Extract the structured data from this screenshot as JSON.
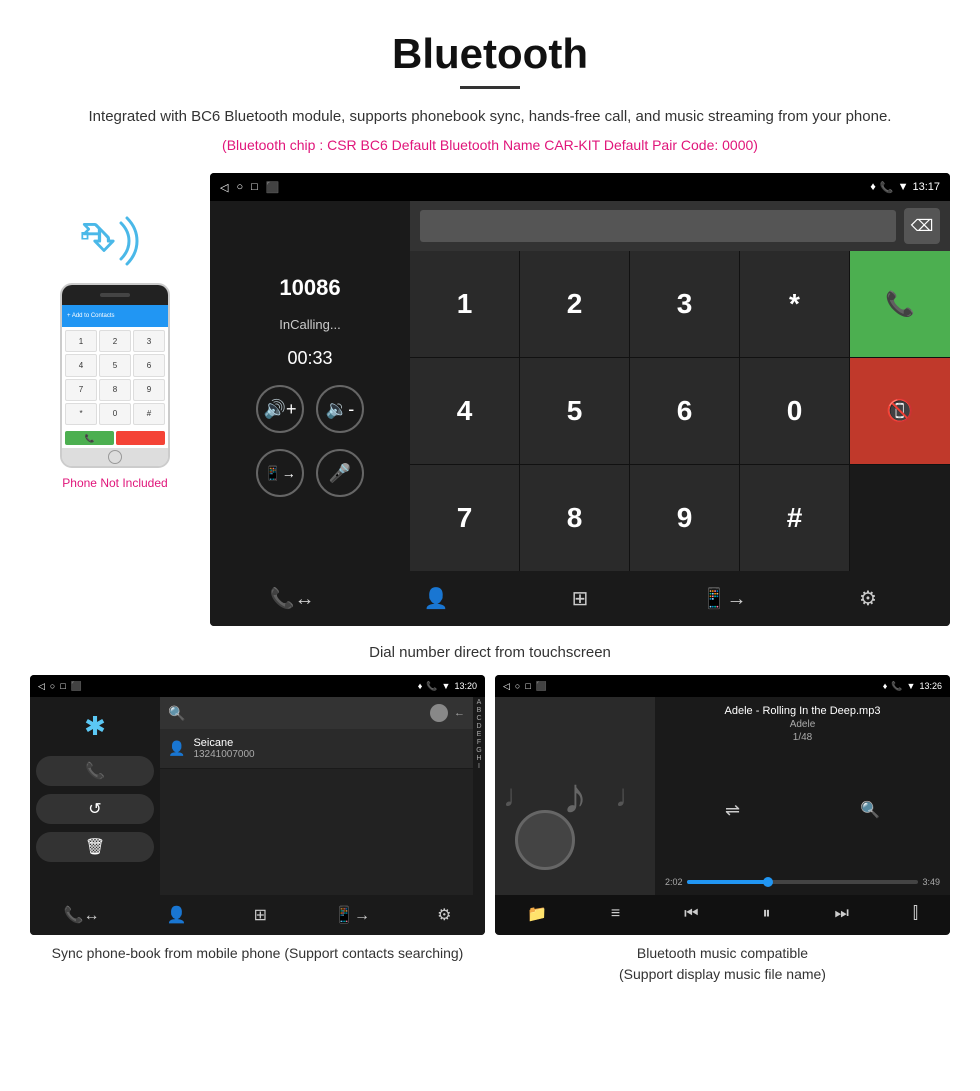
{
  "header": {
    "title": "Bluetooth",
    "description": "Integrated with BC6 Bluetooth module, supports phonebook sync, hands-free call, and music streaming from your phone.",
    "specs": "(Bluetooth chip : CSR BC6    Default Bluetooth Name CAR-KIT    Default Pair Code: 0000)"
  },
  "main_screen": {
    "status_bar": {
      "left": [
        "◁",
        "○",
        "□",
        "⬛"
      ],
      "right": [
        "♥",
        "📞",
        "▼",
        "13:17"
      ]
    },
    "dialer": {
      "number": "10086",
      "status": "InCalling...",
      "timer": "00:33"
    },
    "keypad": {
      "keys": [
        "1",
        "2",
        "3",
        "*",
        "4",
        "5",
        "6",
        "0",
        "7",
        "8",
        "9",
        "#"
      ]
    }
  },
  "main_caption": "Dial number direct from touchscreen",
  "phone": {
    "label": "Phone Not Included",
    "add_contacts": "+ Add to Contacts",
    "keys": [
      "1",
      "2",
      "3",
      "4",
      "5",
      "6",
      "7",
      "8",
      "9",
      "*",
      "0",
      "#"
    ]
  },
  "phonebook_screen": {
    "status_right": "◀ ○ □ ⬛",
    "time": "13:20",
    "contact": {
      "name": "Seicane",
      "number": "13241007000"
    },
    "alpha": [
      "A",
      "B",
      "C",
      "D",
      "E",
      "F",
      "G",
      "H",
      "I"
    ]
  },
  "music_screen": {
    "time": "13:26",
    "track": "Adele - Rolling In the Deep.mp3",
    "artist": "Adele",
    "count": "1/48",
    "time_current": "2:02",
    "time_total": "3:49"
  },
  "captions": {
    "phonebook": "Sync phone-book from mobile phone\n(Support contacts searching)",
    "music": "Bluetooth music compatible\n(Support display music file name)"
  }
}
